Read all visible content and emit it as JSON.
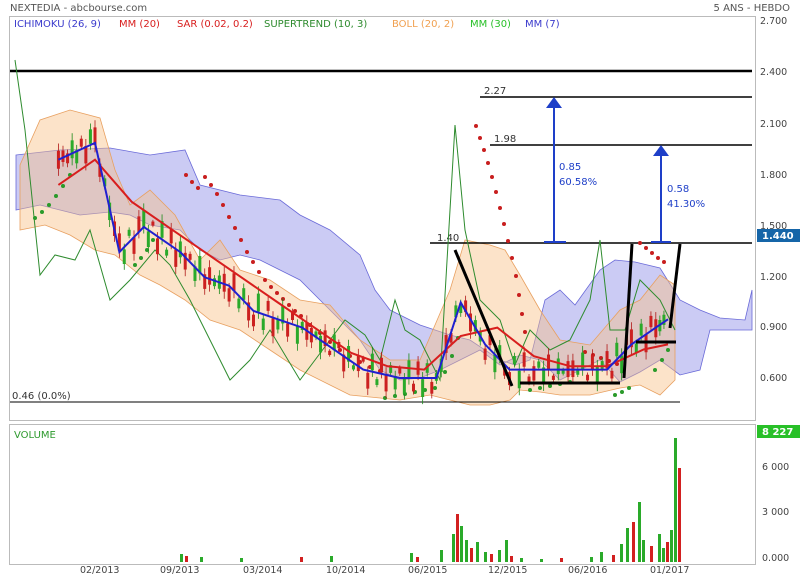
{
  "header": {
    "title": "NEXTEDIA - abcbourse.com",
    "period": "5 ANS - HEBDO",
    "indicators": [
      {
        "label": "ICHIMOKU (26, 9)",
        "color": "#3a3acc"
      },
      {
        "label": "MM (20)",
        "color": "#d81e1e"
      },
      {
        "label": "SAR (0.02, 0.2)",
        "color": "#d81e1e"
      },
      {
        "label": "SUPERTREND (10, 3)",
        "color": "#2e8b2e"
      },
      {
        "label": "BOLL (20, 2)",
        "color": "#f0a050"
      },
      {
        "label": "MM (30)",
        "color": "#28c028"
      },
      {
        "label": "MM (7)",
        "color": "#3a3acc"
      }
    ]
  },
  "chart_data": [
    {
      "type": "line",
      "title": "NEXTEDIA - abcbourse.com",
      "ylim": [
        0.3,
        2.7
      ],
      "y_ticks": [
        "2.700",
        "2.400",
        "2.100",
        "1.800",
        "1.500",
        "1.200",
        "0.900",
        "0.600"
      ],
      "x_ticks": [
        "02/2013",
        "09/2013",
        "03/2014",
        "10/2014",
        "06/2015",
        "12/2015",
        "06/2016",
        "01/2017"
      ],
      "last_price": "1.440",
      "series": [
        {
          "name": "MM (7)",
          "color": "#2020d0",
          "x": [
            "2012-11",
            "2013-02",
            "2013-04",
            "2013-06",
            "2013-09",
            "2013-11",
            "2014-01",
            "2014-03",
            "2014-05",
            "2014-07",
            "2014-10",
            "2014-12",
            "2015-03",
            "2015-06",
            "2015-08",
            "2015-10",
            "2015-12",
            "2016-02",
            "2016-04",
            "2016-06",
            "2016-08",
            "2016-10",
            "2016-12",
            "2017-01"
          ],
          "values": [
            1.85,
            1.95,
            1.3,
            1.45,
            1.3,
            1.15,
            1.1,
            0.95,
            0.9,
            0.85,
            0.7,
            0.6,
            0.55,
            0.55,
            1.0,
            0.75,
            0.6,
            0.6,
            0.6,
            0.6,
            0.6,
            0.75,
            0.85,
            0.9
          ]
        },
        {
          "name": "MM (20)",
          "color": "#d81e1e",
          "x": [
            "2012-11",
            "2013-02",
            "2013-05",
            "2013-08",
            "2013-11",
            "2014-02",
            "2014-05",
            "2014-08",
            "2014-11",
            "2015-02",
            "2015-05",
            "2015-08",
            "2015-11",
            "2016-02",
            "2016-05",
            "2016-08",
            "2016-11",
            "2017-01"
          ],
          "values": [
            1.7,
            1.85,
            1.6,
            1.45,
            1.3,
            1.15,
            1.0,
            0.85,
            0.7,
            0.62,
            0.6,
            0.8,
            0.85,
            0.68,
            0.62,
            0.62,
            0.72,
            0.75
          ]
        }
      ],
      "annotations": [
        {
          "text": "2.27",
          "y": 2.27
        },
        {
          "text": "1.98",
          "y": 1.98
        },
        {
          "text": "1.40",
          "y": 1.4
        },
        {
          "text": "0.46  (0.0%)",
          "y": 0.46
        },
        {
          "text": "0.85",
          "note": "60.58%"
        },
        {
          "text": "0.58",
          "note": "41.30%"
        }
      ],
      "levels": [
        2.4,
        2.27,
        1.98,
        1.4,
        0.46
      ]
    },
    {
      "type": "bar",
      "title": "VOLUME",
      "y_ticks": [
        "6 000",
        "3 000",
        "0.000"
      ],
      "last_volume": "8 227"
    }
  ]
}
